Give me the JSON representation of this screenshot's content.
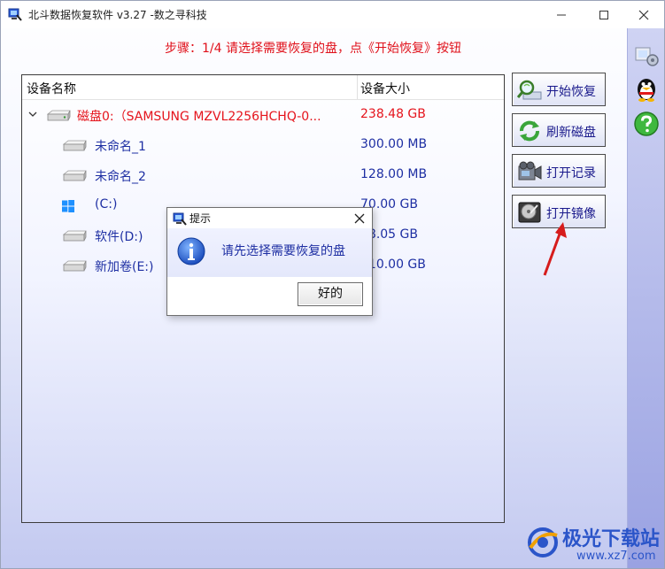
{
  "window": {
    "title": "北斗数据恢复软件 v3.27 -数之寻科技"
  },
  "step_instruction": "步骤：1/4 请选择需要恢复的盘，点《开始恢复》按钮",
  "device_list": {
    "columns": {
      "name": "设备名称",
      "size": "设备大小"
    },
    "rows": [
      {
        "name": "磁盘0:（SAMSUNG MZVL2256HCHQ-0...",
        "size": "238.48 GB",
        "icon": "hard-disk-icon",
        "color": "#e5141c"
      },
      {
        "name": "未命名_1",
        "size": "300.00 MB",
        "icon": "drive-icon",
        "color": "#1e2fa3"
      },
      {
        "name": "未命名_2",
        "size": "128.00 MB",
        "icon": "drive-icon",
        "color": "#1e2fa3"
      },
      {
        "name": "(C:)",
        "size": "70.00 GB",
        "icon": "windows-icon",
        "color": "#1e2fa3"
      },
      {
        "name": "软件(D:)",
        "size": "58.05 GB",
        "icon": "drive-icon",
        "color": "#1e2fa3"
      },
      {
        "name": "新加卷(E:)",
        "size": "110.00 GB",
        "icon": "drive-icon",
        "color": "#1e2fa3"
      }
    ]
  },
  "buttons": {
    "start_recovery": "开始恢复",
    "refresh_disk": "刷新磁盘",
    "open_log": "打开记录",
    "open_image": "打开镜像"
  },
  "dialog": {
    "title": "提示",
    "message": "请先选择需要恢复的盘",
    "ok_label": "好的"
  },
  "watermark": {
    "text": "极光下载站",
    "url": "www.xz7.com"
  },
  "colors": {
    "accent_red": "#e0101a",
    "text_blue": "#1e2fa3",
    "dock": "#9aa2e2"
  }
}
